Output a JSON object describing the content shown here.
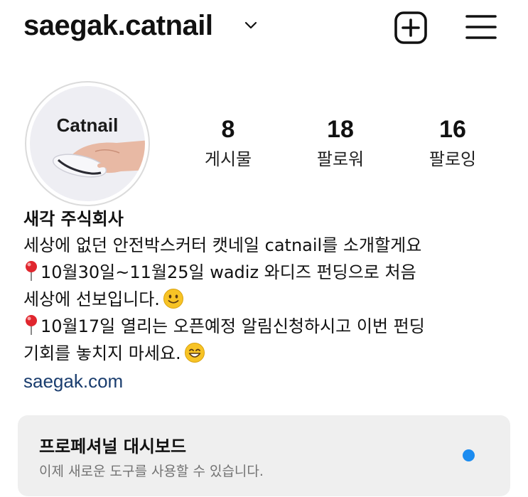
{
  "header": {
    "username": "saegak.catnail",
    "chevron_icon": "chevron-down-icon",
    "new_post_icon": "plus-square-icon",
    "menu_icon": "hamburger-menu-icon"
  },
  "profile": {
    "avatar_logo_text": "Catnail",
    "stats": [
      {
        "value": "8",
        "label": "게시물"
      },
      {
        "value": "18",
        "label": "팔로워"
      },
      {
        "value": "16",
        "label": "팔로잉"
      }
    ]
  },
  "bio": {
    "name": "새각 주식회사",
    "line1": "세상에 없던 안전박스커터 캣네일 catnail를 소개할게요",
    "line2": "10월30일~11월25일 wadiz 와디즈 펀딩으로 처음",
    "line3": "세상에 선보입니다.",
    "line4": "10월17일 열리는 오픈예정 알림신청하시고 이번 펀딩",
    "line5": "기회를 놓치지 마세요.",
    "link": "saegak.com",
    "pin_icon": "red-pin-icon",
    "smile_icon": "slightly-smiling-face-icon",
    "grin_icon": "grinning-face-icon"
  },
  "dashboard": {
    "title": "프로페셔널 대시보드",
    "subtitle": "이제 새로운 도구를 사용할 수 있습니다.",
    "dot_color": "#1c8cf0",
    "background": "#efefef"
  },
  "colors": {
    "link": "#1a3d6e",
    "text": "#111111",
    "muted": "#737373",
    "pin_red": "#e0262e",
    "emoji_yellow": "#f7c325"
  }
}
